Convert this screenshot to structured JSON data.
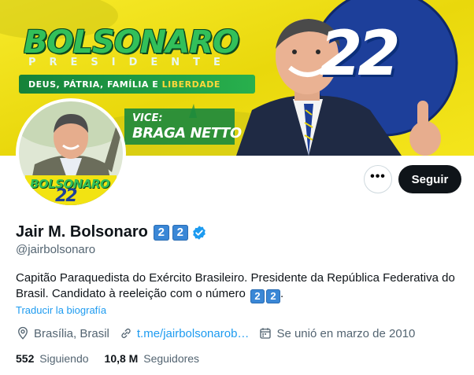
{
  "banner": {
    "title": "BOLSONARO",
    "subtitle": "PRESIDENTE",
    "slogan_main": "DEUS, PÁTRIA, FAMÍLIA E ",
    "slogan_highlight": "LIBERDADE",
    "vice_label": "VICE:",
    "vice_name": "BRAGA NETTO",
    "number": "22"
  },
  "avatar": {
    "text": "BOLSONARO",
    "number": "22"
  },
  "actions": {
    "more_label": "•••",
    "follow_label": "Seguir"
  },
  "profile": {
    "name": "Jair M. Bolsonaro",
    "name_badges": [
      "2",
      "2"
    ],
    "handle": "@jairbolsonaro",
    "bio_line": "Capitão Paraquedista do Exército Brasileiro. Presidente da República Federativa do Brasil. Candidato à reeleição com o número",
    "bio_badges": [
      "2",
      "2"
    ],
    "bio_end": ".",
    "translate_label": "Traducir la biografía",
    "location": "Brasília, Brasil",
    "link": "t.me/jairbolsonarob…",
    "joined": "Se unió en marzo de 2010"
  },
  "stats": {
    "following_count": "552",
    "following_label": "Siguiendo",
    "followers_count": "10,8 M",
    "followers_label": "Seguidores"
  },
  "colors": {
    "accent": "#1d9bf0",
    "banner_yellow": "#f2e312",
    "banner_green": "#1f9a3e",
    "banner_blue": "#1d3f9a",
    "keycap_blue": "#3a87d6"
  }
}
